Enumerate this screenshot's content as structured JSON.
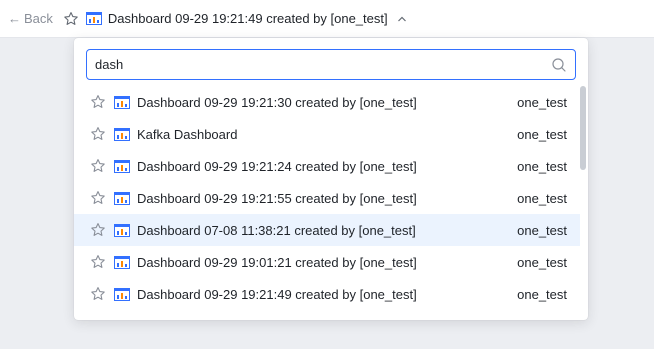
{
  "header": {
    "back_label": "Back",
    "title": "Dashboard 09-29 19:21:49 created by [one_test]"
  },
  "search": {
    "value": "dash"
  },
  "results": [
    {
      "name": "Dashboard 09-29 19:21:30 created by [one_test]",
      "owner": "one_test"
    },
    {
      "name": "Kafka Dashboard",
      "owner": "one_test"
    },
    {
      "name": "Dashboard 09-29 19:21:24 created by [one_test]",
      "owner": "one_test"
    },
    {
      "name": "Dashboard 09-29 19:21:55 created by [one_test]",
      "owner": "one_test"
    },
    {
      "name": "Dashboard 07-08 11:38:21 created by [one_test]",
      "owner": "one_test",
      "highlighted": true
    },
    {
      "name": "Dashboard 09-29 19:01:21 created by [one_test]",
      "owner": "one_test"
    },
    {
      "name": "Dashboard 09-29 19:21:49 created by [one_test]",
      "owner": "one_test"
    }
  ],
  "icons": {
    "back": "arrow-left-icon",
    "favorite": "star-icon",
    "dashboard": "dashboard-icon",
    "collapse": "chevron-up-icon",
    "search": "search-icon"
  },
  "colors": {
    "accent": "#3370ff",
    "highlight_row": "#ebf3fe",
    "muted_text": "#8a8f99"
  }
}
